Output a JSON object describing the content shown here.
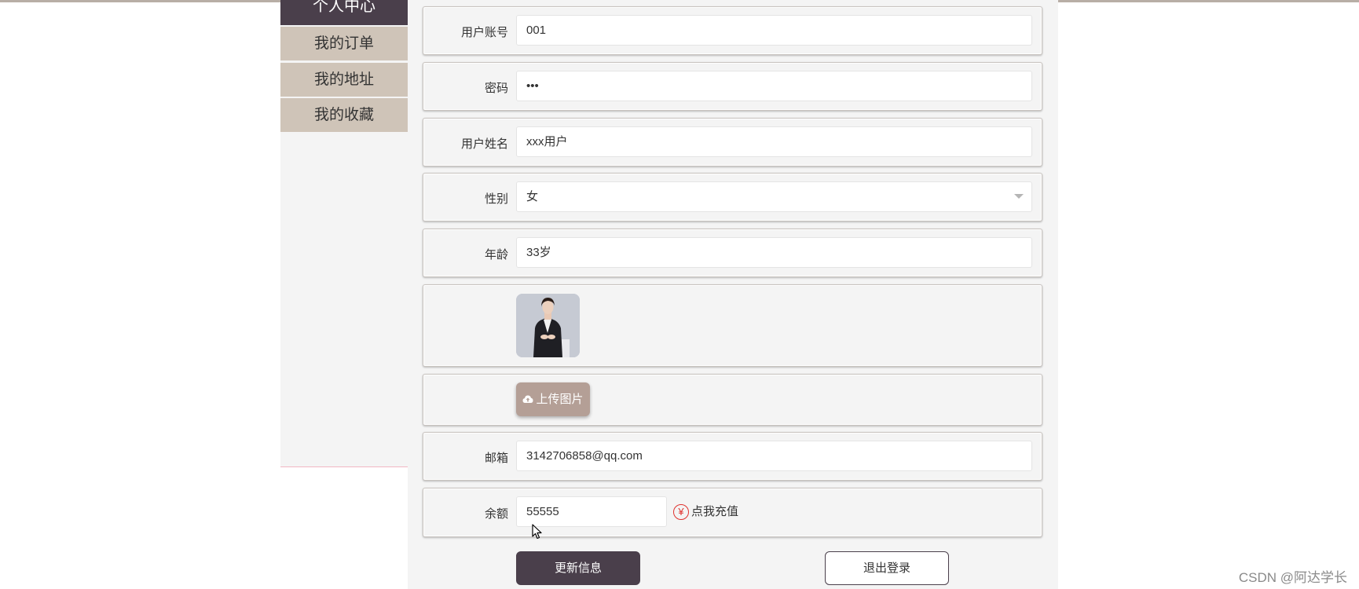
{
  "sidebar": {
    "header": "个人中心",
    "items": [
      {
        "label": "我的订单"
      },
      {
        "label": "我的地址"
      },
      {
        "label": "我的收藏"
      }
    ]
  },
  "form": {
    "account": {
      "label": "用户账号",
      "value": "001"
    },
    "password": {
      "label": "密码",
      "value": "•••"
    },
    "name": {
      "label": "用户姓名",
      "value": "xxx用户"
    },
    "gender": {
      "label": "性别",
      "value": "女"
    },
    "age": {
      "label": "年龄",
      "value": "33岁"
    },
    "upload": {
      "label": "上传图片"
    },
    "email": {
      "label": "邮箱",
      "value": "3142706858@qq.com"
    },
    "balance": {
      "label": "余额",
      "value": "55555",
      "recharge_label": "点我充值"
    }
  },
  "actions": {
    "update_label": "更新信息",
    "logout_label": "退出登录"
  },
  "watermark": "CSDN @阿达学长",
  "icons": {
    "upload": "cloud-upload-icon",
    "recharge": "yen-circle-icon",
    "select": "caret-down-icon"
  },
  "colors": {
    "sidebar_header": "#4a3f4b",
    "sidebar_item": "#cfc4b8",
    "upload_button": "#b49f96",
    "update_button": "#4a3f4b",
    "recharge_icon": "#e0332f"
  }
}
